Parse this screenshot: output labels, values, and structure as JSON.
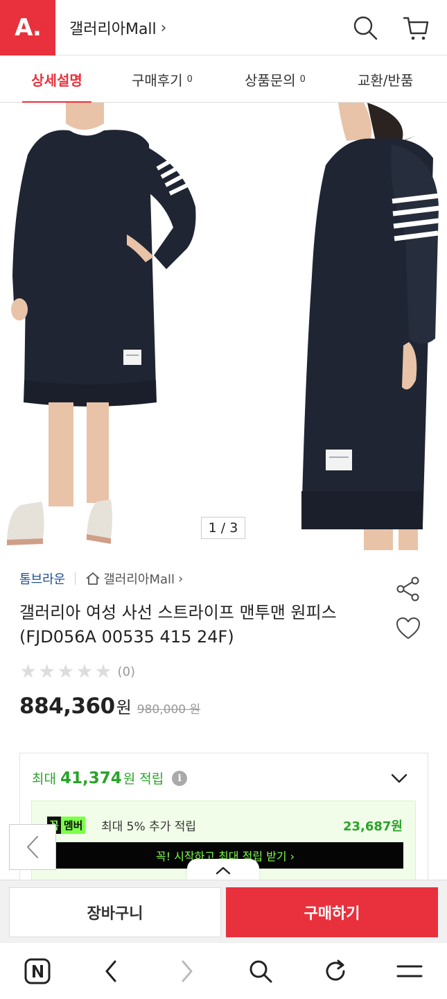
{
  "header": {
    "logo_text": "A.",
    "mall_title": "갤러리아Mall",
    "chevron": "›",
    "icons": [
      "search-icon",
      "cart-icon"
    ]
  },
  "tabs": [
    {
      "label": "상세설명",
      "count": "",
      "active": true
    },
    {
      "label": "구매후기",
      "count": "0",
      "active": false
    },
    {
      "label": "상품문의",
      "count": "0",
      "active": false
    },
    {
      "label": "교환/반품",
      "count": "",
      "active": false
    }
  ],
  "gallery": {
    "counter": "1 / 3"
  },
  "product": {
    "brand": "톰브라운",
    "mall_link": "갤러리아Mall",
    "mall_link_chevron": "›",
    "name": "갤러리아 여성 사선 스트라이프 맨투맨 원피스(FJD056A 00535 415 24F)",
    "rating_stars": 0,
    "review_count": "(0)",
    "price": "884,360",
    "price_unit": "원",
    "original_price": "980,000 원",
    "icons": [
      "share-icon",
      "heart-icon"
    ]
  },
  "points": {
    "prefix": "최대",
    "value": "41,374",
    "suffix": "원 적립",
    "info_glyph": "i",
    "member_badge_dark": "꼭",
    "member_badge_green": "멤버",
    "member_text": "최대 5% 추가 적립",
    "member_value": "23,687원",
    "member_cta": "꼭! 시작하고 최대 적립 받기  ›"
  },
  "buybar": {
    "cart_label": "장바구니",
    "buy_label": "구매하기"
  },
  "colors": {
    "brand_red": "#e8313c",
    "point_green": "#2aa32a",
    "neon_green": "#7dff4a",
    "brand_link_blue": "#1d4e91"
  },
  "browser_nav": {
    "icons": [
      "naver-n-icon",
      "back-icon",
      "forward-icon",
      "search-icon",
      "refresh-icon",
      "menu-icon"
    ]
  }
}
